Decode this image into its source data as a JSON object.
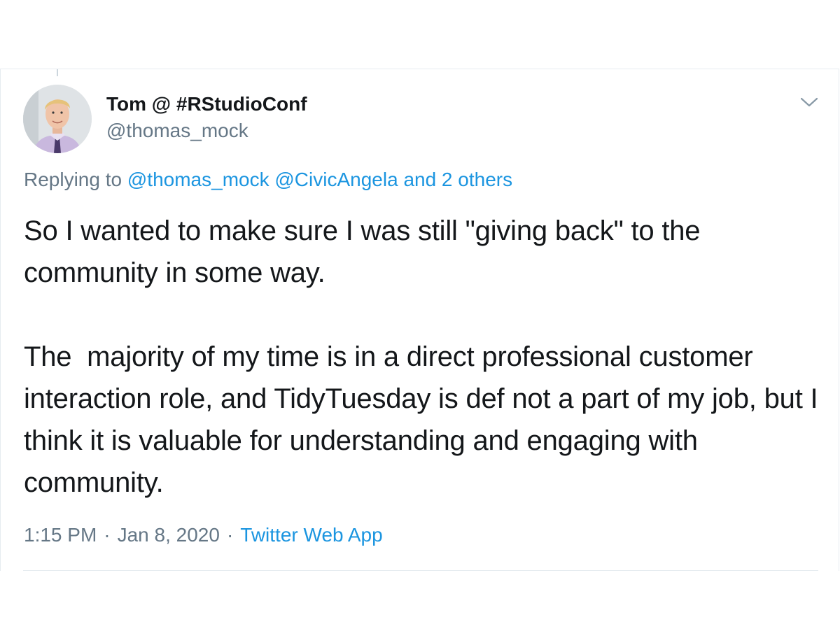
{
  "tweet": {
    "author": {
      "display_name": "Tom @ #RStudioConf",
      "handle": "@thomas_mock"
    },
    "reply": {
      "prefix": "Replying to",
      "mentions": [
        "@thomas_mock",
        "@CivicAngela"
      ],
      "others": "and 2 others"
    },
    "text": "So I wanted to make sure I was still \"giving back\" to the community in some way.\n\nThe  majority of my time is in a direct professional customer interaction role, and TidyTuesday is def not a part of my job, but I think it is valuable for understanding and engaging with community.",
    "meta": {
      "time": "1:15 PM",
      "separator": "·",
      "date": "Jan 8, 2020",
      "source": "Twitter Web App"
    },
    "icons": {
      "more": "chevron-down-icon"
    },
    "colors": {
      "link": "#1b95e0",
      "secondary_text": "#657786",
      "primary_text": "#14171a",
      "border": "#e6ecf0"
    }
  }
}
